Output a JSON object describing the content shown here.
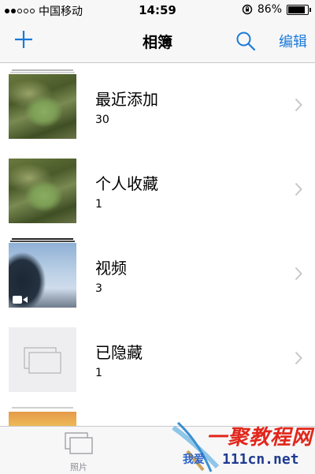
{
  "status_bar": {
    "carrier": "中国移动",
    "time": "14:59",
    "battery_percent": "86%",
    "battery_level": 0.86,
    "signal_bars_filled": 2,
    "signal_bars_total": 5
  },
  "nav": {
    "add_icon": "plus-icon",
    "title": "相簿",
    "search_icon": "search-icon",
    "edit_label": "编辑",
    "accent_color": "#1a7ad8"
  },
  "albums": [
    {
      "name": "最近添加",
      "count": "30",
      "thumb": "plant-photo"
    },
    {
      "name": "个人收藏",
      "count": "1",
      "thumb": "plant-photo"
    },
    {
      "name": "视频",
      "count": "3",
      "thumb": "tree-sky-photo"
    },
    {
      "name": "已隐藏",
      "count": "1",
      "thumb": "hidden-placeholder"
    }
  ],
  "tab_bar": {
    "photos_label": "照片",
    "photos_icon": "photos-stack-icon"
  },
  "watermark": {
    "text": "一聚教程网",
    "small_text": "我爱",
    "url": "111cn.net"
  }
}
